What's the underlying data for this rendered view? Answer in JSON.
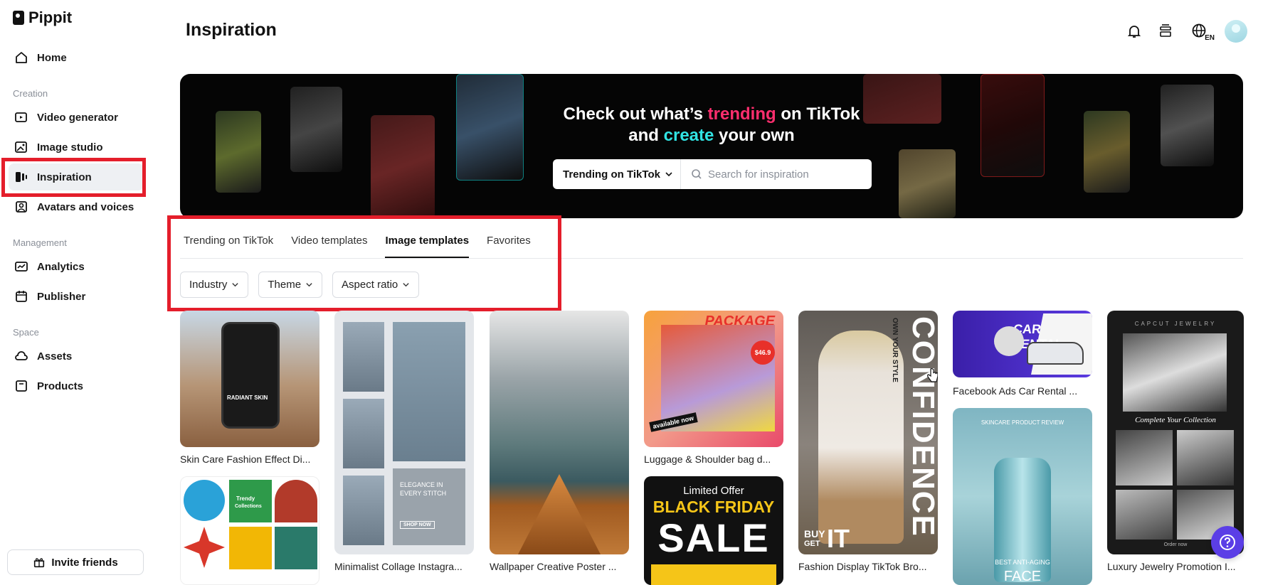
{
  "app": {
    "name": "Pippit"
  },
  "sidebar": {
    "home": "Home",
    "sections": {
      "creation": "Creation",
      "management": "Management",
      "space": "Space"
    },
    "items": {
      "video_generator": "Video generator",
      "image_studio": "Image studio",
      "inspiration": "Inspiration",
      "avatars": "Avatars and voices",
      "analytics": "Analytics",
      "publisher": "Publisher",
      "assets": "Assets",
      "products": "Products"
    },
    "invite": "Invite friends"
  },
  "header": {
    "title": "Inspiration",
    "language_badge": "EN",
    "icons": [
      "bell-icon",
      "layers-icon",
      "globe-icon",
      "avatar"
    ]
  },
  "banner": {
    "line1_a": "Check out what’s ",
    "line1_b": "trending",
    "line1_c": " on TikTok",
    "line2_a": "and ",
    "line2_b": "create",
    "line2_c": " your own",
    "select_value": "Trending on TikTok",
    "search_placeholder": "Search for inspiration"
  },
  "tabs": [
    "Trending on TikTok",
    "Video templates",
    "Image templates",
    "Favorites"
  ],
  "active_tab": "Image templates",
  "filters": [
    "Industry",
    "Theme",
    "Aspect ratio"
  ],
  "cards": {
    "c1": {
      "label": "Skin Care Fashion Effect Di...",
      "t1": "RADIANT SKIN"
    },
    "c2": {
      "t1": "Trendy",
      "t2": "Collections"
    },
    "c3": {
      "label": "Minimalist Collage Instagra...",
      "t1": "ELEGANCE IN",
      "t2": "EVERY STITCH",
      "t3": "SHOP NOW"
    },
    "c4": {
      "label": "Wallpaper Creative Poster ..."
    },
    "c5": {
      "label": "Luggage & Shoulder bag d...",
      "t1": "PACKAGE",
      "t2": "$46.9",
      "t3": "available now"
    },
    "c6": {
      "t1": "Limited Offer",
      "t2": "BLACK FRIDAY",
      "t3": "SALE"
    },
    "c7": {
      "label": "Fashion Display TikTok Bro...",
      "t1": "CONFIDENCE",
      "t2": "OWN YOUR STYLE",
      "t3": "BUY",
      "t4": "GET",
      "t5": "IT"
    },
    "c8": {
      "label": "Facebook Ads Car Rental ...",
      "t1": "CAR RENTAL"
    },
    "c9": {
      "t1": "SKINCARE PRODUCT REVIEW",
      "t2": "BEST ANTI-AGING",
      "t3": "FACE"
    },
    "c10": {
      "label": "Luxury Jewelry Promotion I...",
      "t1": "CAPCUT JEWELRY",
      "t2": "Complete Your Collection",
      "t3": "Order now"
    }
  },
  "colors": {
    "accent_pink": "#ff2e6e",
    "accent_cyan": "#31e4e4",
    "highlight_red": "#e41e2b",
    "help_purple": "#5b3ee6"
  }
}
